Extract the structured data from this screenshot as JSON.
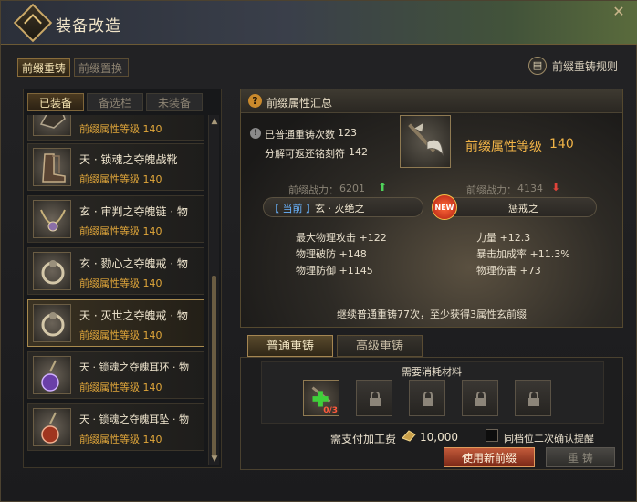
{
  "window": {
    "title": "装备改造",
    "close_icon": "close-icon"
  },
  "top_tabs": [
    {
      "label": "前缀重铸",
      "active": true
    },
    {
      "label": "前缀置换",
      "active": false
    }
  ],
  "rule_link": {
    "label": "前缀重铸规则",
    "icon": "book-icon"
  },
  "sub_tabs": [
    {
      "label": "已装备",
      "active": true
    },
    {
      "label": "备选栏",
      "active": false
    },
    {
      "label": "未装备",
      "active": false
    }
  ],
  "items": [
    {
      "name": "",
      "level_text": "前缀属性等级 140",
      "icon": "gloves-icon",
      "selected": false
    },
    {
      "name": "天 · 锁魂之夺魄战靴",
      "level_text": "前缀属性等级 140",
      "icon": "boots-icon",
      "selected": false
    },
    {
      "name": "玄 · 审判之夺魄链 · 物",
      "level_text": "前缀属性等级 140",
      "icon": "necklace-icon",
      "selected": false
    },
    {
      "name": "玄 · 勠心之夺魄戒 · 物",
      "level_text": "前缀属性等级 140",
      "icon": "ring-icon",
      "selected": false
    },
    {
      "name": "天 · 灭世之夺魄戒 · 物",
      "level_text": "前缀属性等级 140",
      "icon": "ring-icon",
      "selected": true
    },
    {
      "name": "天 · 锁魂之夺魄耳环 · 物",
      "level_text": "前缀属性等级 140",
      "icon": "earring-purple-icon",
      "selected": false
    },
    {
      "name": "天 · 锁魂之夺魄耳坠 · 物",
      "level_text": "前缀属性等级 140",
      "icon": "earring-red-icon",
      "selected": false
    }
  ],
  "summary": {
    "title": "前缀属性汇总",
    "reforge_count_label": "已普通重铸次数",
    "reforge_count": "123",
    "return_label": "分解可返还铭刻符",
    "return_count": "142",
    "weapon_label": "前缀属性等级",
    "weapon_level": "140",
    "current_power_label": "前缀战力：",
    "current_power": "6201",
    "new_power_label": "前缀战力：",
    "new_power": "4134",
    "current_tag": "【 当前 】",
    "current_prefix": "玄 · 灭绝之",
    "new_badge": "NEW",
    "new_prefix": "惩戒之",
    "current_attrs": [
      "最大物理攻击 +122",
      "物理破防 +148",
      "物理防御 +1145"
    ],
    "new_attrs": [
      "力量 +12.3",
      "暴击加成率 +11.3%",
      "物理伤害 +73"
    ],
    "continue_text": "继续普通重铸77次，至少获得3属性玄前缀"
  },
  "reforge_tabs": [
    {
      "label": "普通重铸",
      "active": true
    },
    {
      "label": "高级重铸",
      "active": false
    }
  ],
  "materials": {
    "title": "需要消耗材料",
    "add_slot_count": "0/3",
    "fee_label": "需支付加工费",
    "fee_value": "10,000",
    "confirm_label": "同档位二次确认提醒",
    "use_prefix_button": "使用新前缀",
    "reforge_button": "重 铸"
  },
  "colors": {
    "level_orange": "#e0a63a",
    "highlight_gold": "#f0b347",
    "up_green": "#4fd25a",
    "down_red": "#e0433a",
    "current_blue": "#6ab4ff"
  }
}
